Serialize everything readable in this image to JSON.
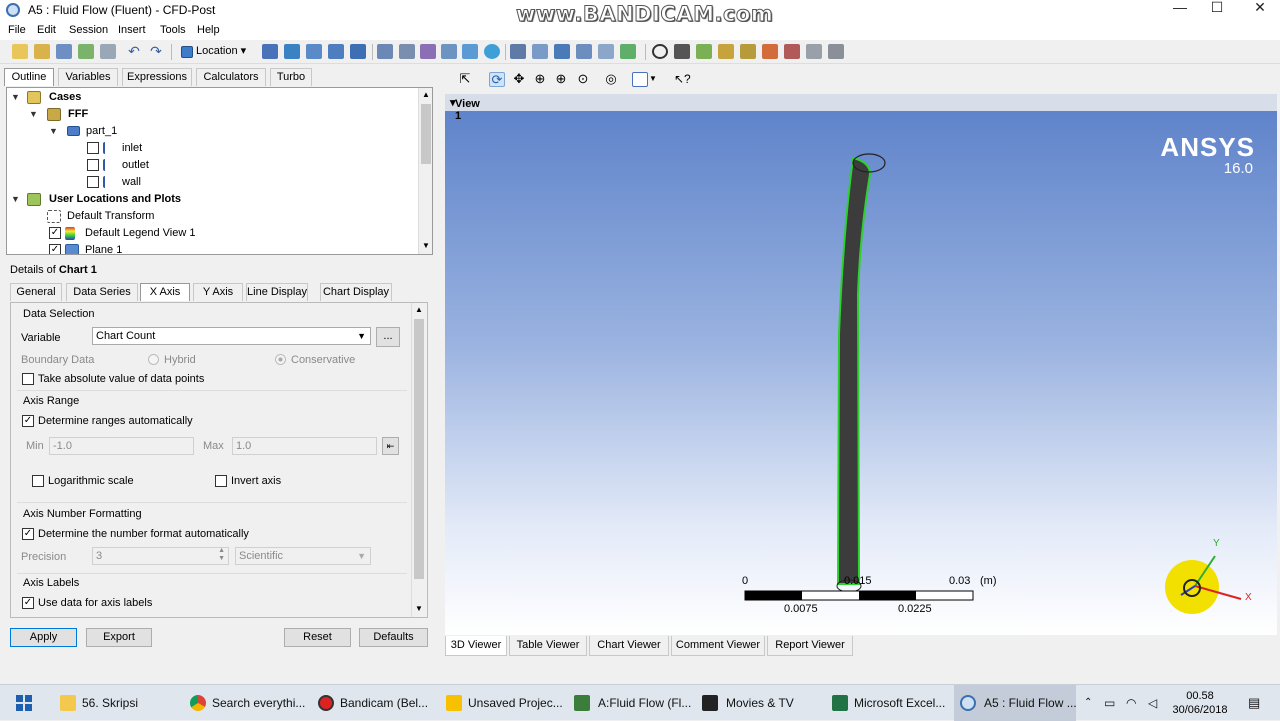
{
  "window": {
    "title": "A5 : Fluid Flow (Fluent) - CFD-Post",
    "watermark": "www.BANDICAM.com",
    "controls": {
      "minimize": "—",
      "maximize": "☐",
      "close": "✕"
    }
  },
  "menu": [
    "File",
    "Edit",
    "Session",
    "Insert",
    "Tools",
    "Help"
  ],
  "toolbar": {
    "location_label": "Location"
  },
  "outline_tabs": [
    "Outline",
    "Variables",
    "Expressions",
    "Calculators",
    "Turbo"
  ],
  "tree": {
    "cases": "Cases",
    "fff": "FFF",
    "part": "part_1",
    "inlet": "inlet",
    "outlet": "outlet",
    "wall": "wall",
    "user_locations": "User Locations and Plots",
    "default_transform": "Default Transform",
    "default_legend": "Default Legend View 1",
    "plane": "Plane 1"
  },
  "details": {
    "prefix": "Details of ",
    "object": "Chart 1",
    "tabs": [
      "General",
      "Data Series",
      "X Axis",
      "Y Axis",
      "Line Display",
      "Chart Display"
    ],
    "data_selection": "Data Selection",
    "variable_label": "Variable",
    "variable_value": "Chart Count",
    "browse": "...",
    "boundary_data": "Boundary Data",
    "hybrid": "Hybrid",
    "conservative": "Conservative",
    "take_abs": "Take absolute value of data points",
    "axis_range": "Axis Range",
    "determine_ranges": "Determine ranges automatically",
    "min_label": "Min",
    "min_value": "-1.0",
    "max_label": "Max",
    "max_value": "1.0",
    "log_scale": "Logarithmic scale",
    "invert_axis": "Invert axis",
    "axis_number_formatting": "Axis Number Formatting",
    "determine_format": "Determine the number format automatically",
    "precision_label": "Precision",
    "precision_value": "3",
    "precision_format": "Scientific",
    "axis_labels": "Axis Labels",
    "use_data_labels": "Use data for axis labels"
  },
  "buttons": {
    "apply": "Apply",
    "export": "Export",
    "reset": "Reset",
    "defaults": "Defaults"
  },
  "viewer": {
    "view_label": "View 1",
    "ansys": "ANSYS",
    "ansys_version": "16.0",
    "scale_labels": [
      "0",
      "0.015",
      "0.03",
      "(m)"
    ],
    "scale_sub_labels": [
      "0.0075",
      "0.0225"
    ],
    "axis_x": "X",
    "axis_y": "Y"
  },
  "viewer_tabs": [
    "3D Viewer",
    "Table Viewer",
    "Chart Viewer",
    "Comment Viewer",
    "Report Viewer"
  ],
  "taskbar": {
    "items": [
      "56. Skripsi",
      "Search everythi...",
      "Bandicam (Bel...",
      "Unsaved Projec...",
      "A:Fluid Flow (Fl...",
      "Movies & TV",
      "Microsoft Excel...",
      "A5 : Fluid Flow ..."
    ],
    "time": "00.58",
    "date": "30/06/2018"
  }
}
